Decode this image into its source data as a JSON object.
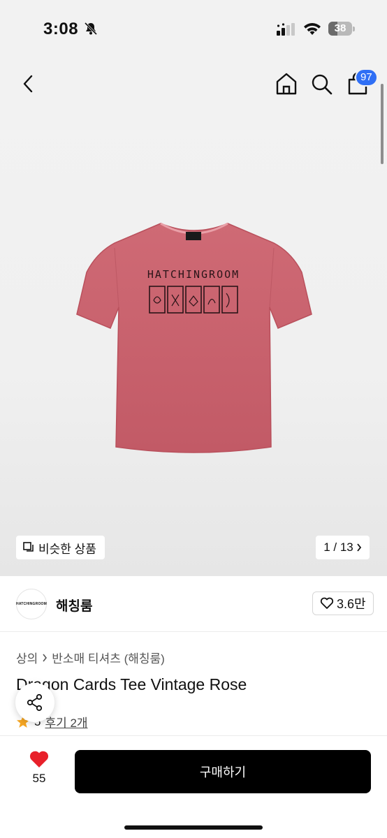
{
  "status_bar": {
    "time": "3:08",
    "battery": "38",
    "battery_level": 0.38
  },
  "header": {
    "cart_badge": "97"
  },
  "gallery": {
    "similar_label": "비슷한 상품",
    "page_counter": "1 / 13",
    "print_text": "HATCHINGROOM"
  },
  "brand": {
    "logo_text": "HATCHINGROOM",
    "name": "해칭룸",
    "likes": "3.6만"
  },
  "product": {
    "breadcrumb": [
      "상의",
      "반소매 티셔츠 (해칭룸)"
    ],
    "title": "Dragon Cards Tee Vintage Rose",
    "rating": "5",
    "reviews": "후기 2개"
  },
  "bottom_bar": {
    "like_count": "55",
    "buy_label": "구매하기"
  },
  "colors": {
    "accent_badge": "#2f6ff5",
    "heart": "#e8202a",
    "star": "#f6a623",
    "shirt": "#c8616d"
  }
}
